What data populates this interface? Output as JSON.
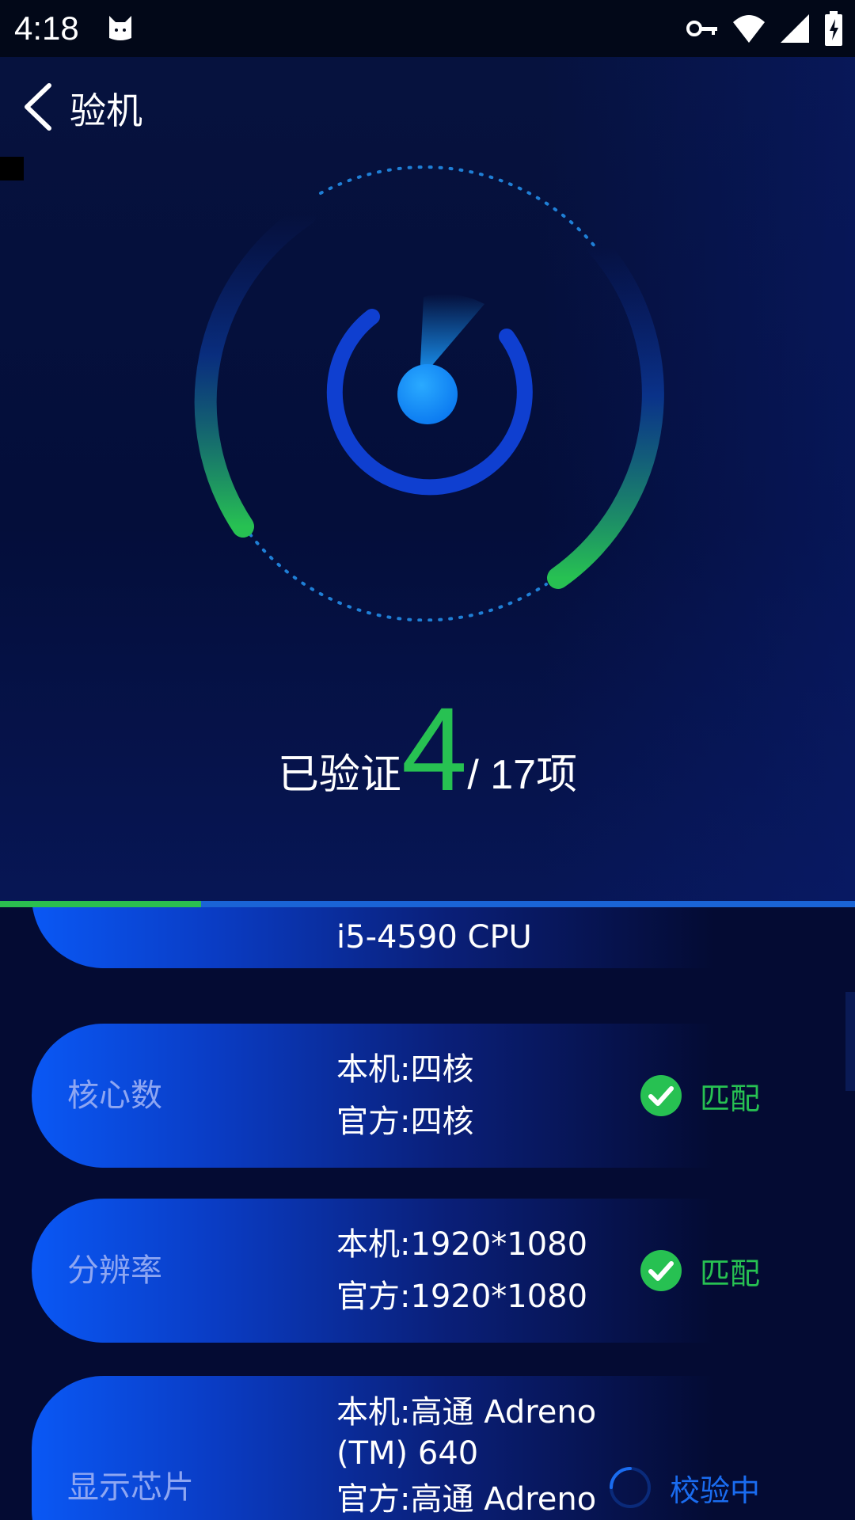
{
  "status_bar": {
    "time": "4:18"
  },
  "header": {
    "title": "验机"
  },
  "summary": {
    "prefix": "已验证",
    "verified": "4",
    "total": "/ 17项",
    "progress_fraction": 0.235
  },
  "colors": {
    "accent_green": "#27c152",
    "accent_blue": "#0a58f5",
    "checking_blue": "#1a6cf0"
  },
  "items": [
    {
      "label": "",
      "values": [
        "i5-4590 CPU"
      ],
      "status": ""
    },
    {
      "label": "核心数",
      "values": [
        "本机:四核",
        "官方:四核"
      ],
      "status": "匹配",
      "status_icon": "check-circle-icon"
    },
    {
      "label": "分辨率",
      "values": [
        "本机:1920*1080",
        "官方:1920*1080"
      ],
      "status": "匹配",
      "status_icon": "check-circle-icon"
    },
    {
      "label": "显示芯片",
      "values": [
        "本机:高通 Adreno",
        "(TM) 640",
        "官方:高通 Adreno"
      ],
      "status": "校验中",
      "status_icon": "spinner-icon"
    }
  ]
}
